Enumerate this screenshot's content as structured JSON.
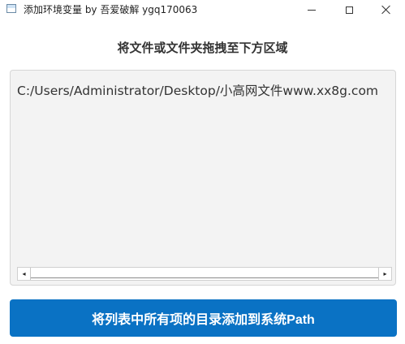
{
  "window": {
    "title": "添加环境变量 by 吾爱破解 ygq170063"
  },
  "heading": "将文件或文件夹拖拽至下方区域",
  "list": {
    "items": [
      "C:/Users/Administrator/Desktop/小高网文件www.xx8g.com"
    ]
  },
  "scrollbar": {
    "left_arrow": "◂",
    "right_arrow": "▸"
  },
  "action": {
    "label": "将列表中所有项的目录添加到系统Path"
  },
  "colors": {
    "primary": "#0a72c4",
    "list_bg": "#f3f3f3"
  }
}
